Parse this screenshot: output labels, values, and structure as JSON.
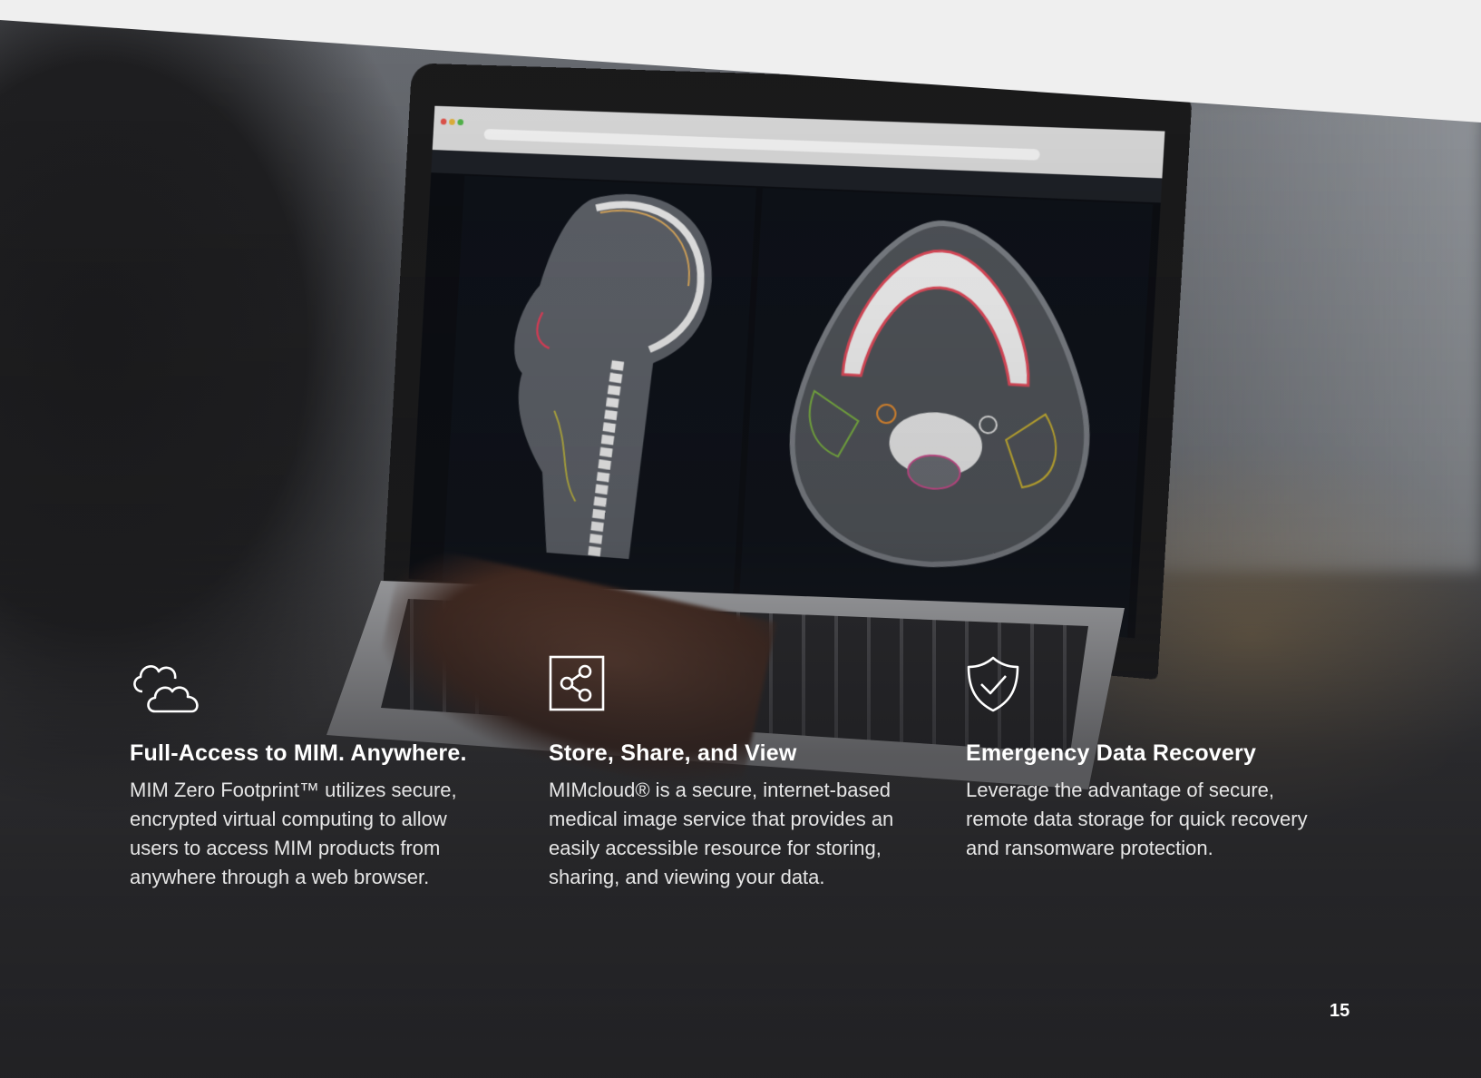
{
  "features": [
    {
      "icon": "cloud-icon",
      "title": "Full-Access to MIM. Anywhere.",
      "body": "MIM Zero Footprint™ utilizes secure, encrypted virtual computing to allow users to access MIM products from anywhere through a web browser."
    },
    {
      "icon": "share-icon",
      "title": "Store, Share, and View",
      "body": "MIMcloud® is a secure, internet-based medical image service that provides an easily accessible resource for storing, sharing, and viewing your data."
    },
    {
      "icon": "shield-check-icon",
      "title": "Emergency Data Recovery",
      "body": "Leverage the advantage of secure, remote data storage for quick recovery and ransomware protection."
    }
  ],
  "page_number": "15",
  "colors": {
    "text": "#ffffff",
    "top_band": "#efefef"
  }
}
